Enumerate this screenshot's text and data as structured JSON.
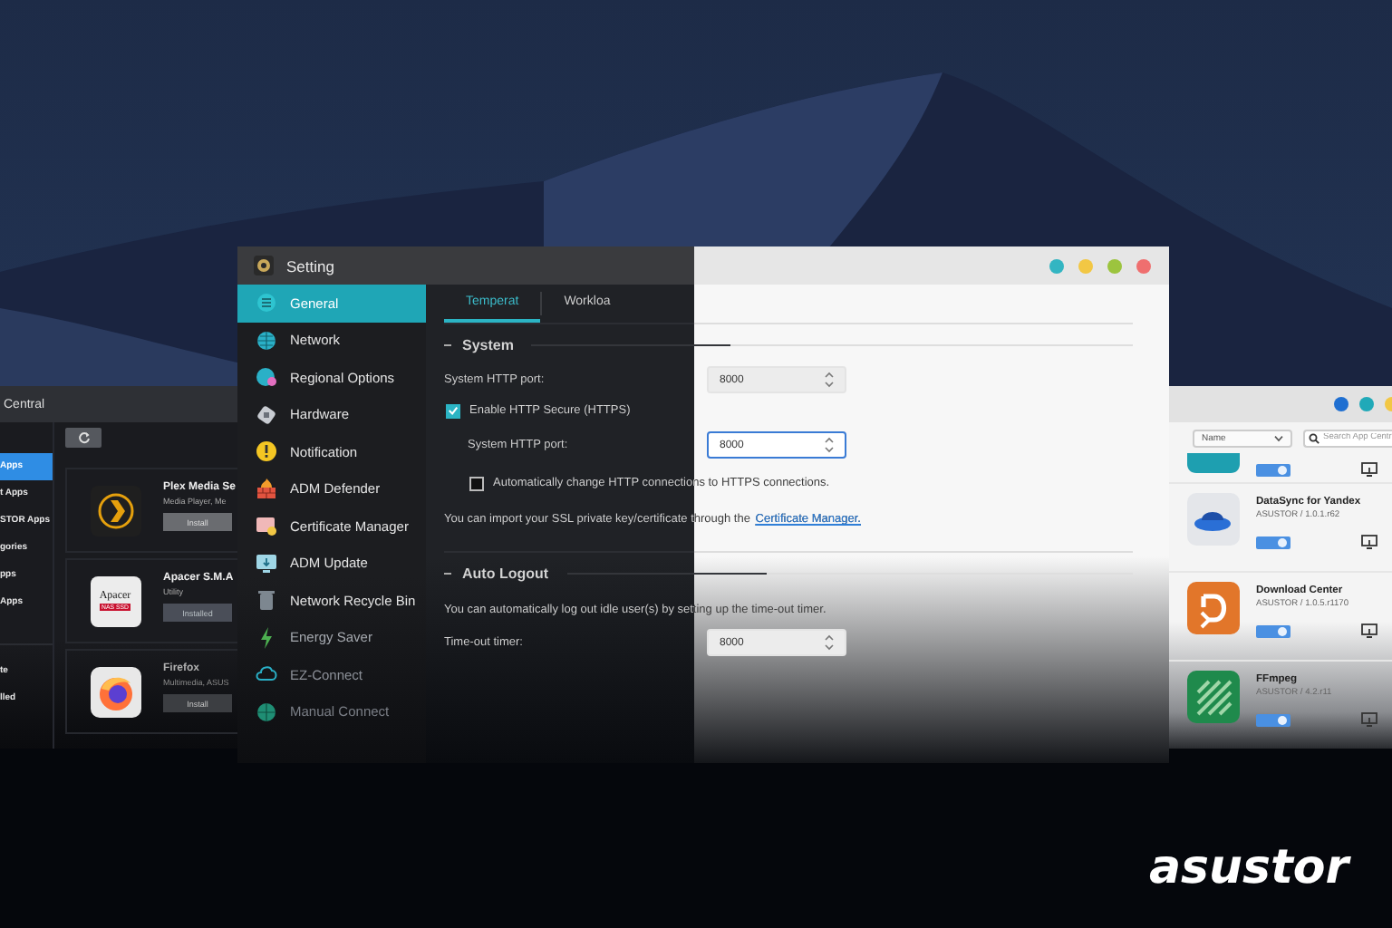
{
  "app_central": {
    "title": "Central",
    "sidebar": [
      {
        "label": "Apps",
        "selected": true
      },
      {
        "label": "t Apps",
        "selected": false
      },
      {
        "label": "STOR Apps",
        "selected": false
      },
      {
        "label": "gories",
        "selected": false
      },
      {
        "label": "pps",
        "selected": false
      },
      {
        "label": "Apps",
        "selected": false
      }
    ],
    "sidebar_bottom": [
      {
        "label": "te",
        "selected": false
      },
      {
        "label": "lled",
        "selected": false
      }
    ],
    "apps": [
      {
        "kind": "plex",
        "name": "Plex Media Se",
        "category": "Media Player, Me",
        "button": "Install",
        "disabled": false
      },
      {
        "kind": "apacer",
        "name": "Apacer S.M.A",
        "category": "Utility",
        "button": "Installed",
        "disabled": true,
        "logo": "Apacer",
        "logo_tag": "NAS SSD"
      },
      {
        "kind": "firefox",
        "name": "Firefox",
        "category": "Multimedia, ASUS",
        "button": "Install",
        "disabled": false
      }
    ]
  },
  "settings": {
    "title": "Setting",
    "sidebar": [
      {
        "label": "General",
        "selected": true
      },
      {
        "label": "Network",
        "selected": false
      },
      {
        "label": "Regional Options",
        "selected": false
      },
      {
        "label": "Hardware",
        "selected": false
      },
      {
        "label": "Notification",
        "selected": false
      },
      {
        "label": "ADM Defender",
        "selected": false
      },
      {
        "label": "Certificate Manager",
        "selected": false
      },
      {
        "label": "ADM Update",
        "selected": false
      },
      {
        "label": "Network Recycle Bin",
        "selected": false
      },
      {
        "label": "Energy Saver",
        "selected": false
      },
      {
        "label": "EZ-Connect",
        "selected": false
      },
      {
        "label": "Manual Connect",
        "selected": false
      }
    ],
    "tabs": [
      {
        "label": "Temperat",
        "selected": true
      },
      {
        "label": "Workloa",
        "selected": false
      }
    ],
    "sections": [
      {
        "title": "System",
        "rows": [
          {
            "kind": "field",
            "label": "System HTTP port:",
            "value": "8000",
            "focused": false
          },
          {
            "kind": "checkbox",
            "label": "Enable HTTP Secure (HTTPS)",
            "checked": true,
            "children": [
              {
                "kind": "field",
                "label": "System HTTP port:",
                "value": "8000",
                "focused": true
              },
              {
                "kind": "checkbox",
                "label": "Automatically change HTTP connections to HTTPS connections.",
                "checked": false
              }
            ]
          },
          {
            "kind": "note",
            "text": "You can import your SSL private key/certificate through the ",
            "link": "Certificate Manager."
          }
        ]
      },
      {
        "title": "Auto Logout",
        "rows": [
          {
            "kind": "note",
            "text": "You can automatically log out idle user(s) by setting up the time-out timer."
          },
          {
            "kind": "field",
            "label": "Time-out timer:",
            "value": "8000",
            "focused": false
          }
        ]
      }
    ]
  },
  "installed_apps": {
    "sort": "Name",
    "search": {
      "placeholder": "Search App Centr"
    },
    "items": [
      {
        "kind": "partial",
        "on": true
      },
      {
        "kind": "yandex",
        "name": "DataSync for Yandex",
        "publisher": "ASUSTOR / 1.0.1.r62",
        "on": true
      },
      {
        "kind": "download",
        "name": "Download Center",
        "publisher": "ASUSTOR / 1.0.5.r1170",
        "on": true
      },
      {
        "kind": "ffmpeg",
        "name": "FFmpeg",
        "publisher": "ASUSTOR / 4.2.r11",
        "on": true
      }
    ]
  },
  "brand": {
    "logo": "asustor"
  }
}
